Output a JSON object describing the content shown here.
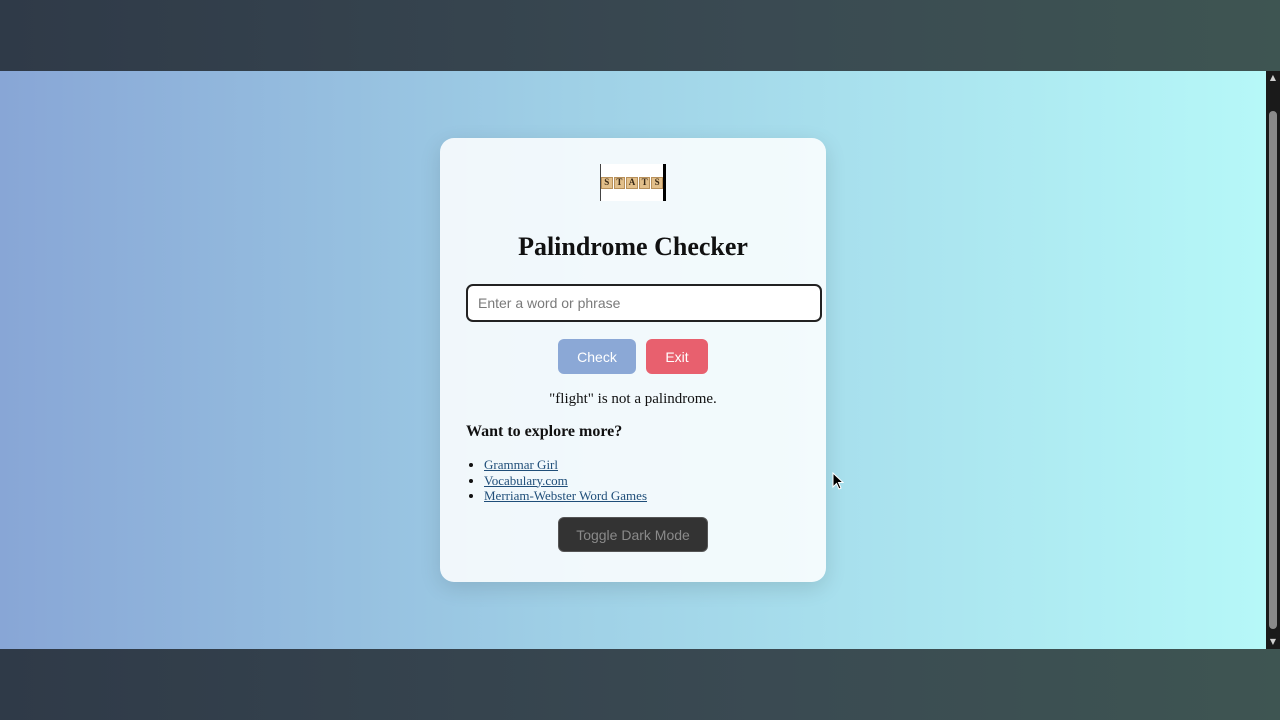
{
  "logo": {
    "tiles": [
      "S",
      "T",
      "A",
      "T",
      "S"
    ]
  },
  "page": {
    "title": "Palindrome Checker",
    "input_placeholder": "Enter a word or phrase",
    "input_value": "",
    "check_label": "Check",
    "exit_label": "Exit",
    "result_text": "\"flight\" is not a palindrome.",
    "explore_heading": "Want to explore more?",
    "links": [
      {
        "label": "Grammar Girl"
      },
      {
        "label": "Vocabulary.com"
      },
      {
        "label": "Merriam-Webster Word Games"
      }
    ],
    "dark_mode_label": "Toggle Dark Mode"
  },
  "colors": {
    "check_button": "#8ba8d6",
    "exit_button": "#e8606e",
    "dark_mode_button": "#333333",
    "link": "#1f4e79"
  },
  "icons": {
    "cursor": "arrow-cursor-icon",
    "scroll_up": "scroll-up-arrow-icon",
    "scroll_down": "scroll-down-arrow-icon"
  }
}
